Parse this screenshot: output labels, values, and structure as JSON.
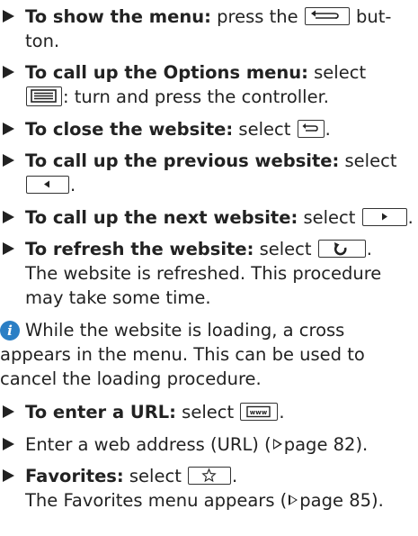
{
  "items": [
    {
      "bold": "To show the menu:",
      "pre": " press the ",
      "post1": " but-",
      "line2": "ton."
    },
    {
      "bold": "To call up the Options menu:",
      "pre": " select",
      "post2": ": turn and press the controller."
    },
    {
      "bold": "To close the website:",
      "pre": " select ",
      "post": "."
    },
    {
      "bold": "To call up the previous website:",
      "pre": " select",
      "post": "."
    },
    {
      "bold": "To call up the next website:",
      "pre": " select ",
      "post": "."
    },
    {
      "bold": "To refresh the website:",
      "pre": " select ",
      "post": ".",
      "line2": "The website is refreshed. This procedure",
      "line3": "may take some time."
    },
    {
      "note": [
        "While the website is loading, a cross",
        "appears in the menu. This can be used to",
        "cancel the loading procedure."
      ]
    },
    {
      "bold": "To enter a URL:",
      "pre": " select ",
      "post": "."
    },
    {
      "text_pre": "Enter a web address (URL) (",
      "page": "page 82",
      "text_post": ")."
    },
    {
      "bold": "Favorites:",
      "pre": " select ",
      "post": ".",
      "line2_pre": "The Favorites menu appears (",
      "page": "page 85",
      "line2_post": ")."
    }
  ],
  "icons": {
    "back": "back-button-icon",
    "options": "options-menu-icon",
    "close": "close-website-icon",
    "previous": "previous-arrow-icon",
    "next": "next-arrow-icon",
    "refresh": "refresh-icon",
    "info": "info-icon",
    "url": "www-icon",
    "favorites": "star-icon"
  },
  "info_glyph": "i",
  "colors": {
    "info_icon": "#2b7fc5",
    "text": "#222222"
  }
}
